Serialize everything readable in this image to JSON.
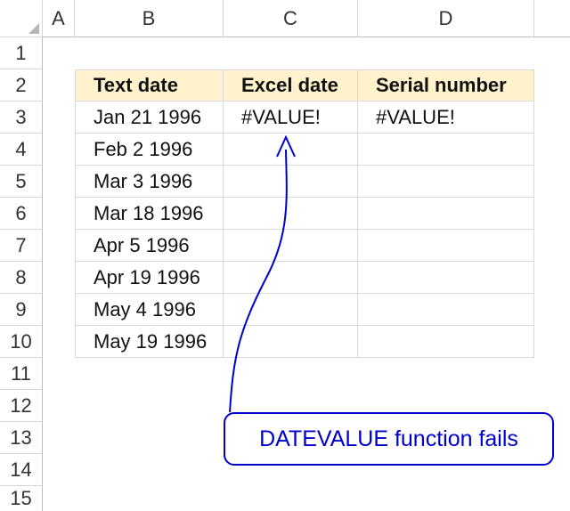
{
  "columns": [
    "A",
    "B",
    "C",
    "D"
  ],
  "rows": [
    "1",
    "2",
    "3",
    "4",
    "5",
    "6",
    "7",
    "8",
    "9",
    "10",
    "11",
    "12",
    "13",
    "14",
    "15"
  ],
  "table": {
    "headers": [
      "Text date",
      "Excel date",
      "Serial number"
    ],
    "data": [
      [
        "Jan 21 1996",
        "#VALUE!",
        "#VALUE!"
      ],
      [
        "Feb 2 1996",
        "",
        ""
      ],
      [
        "Mar 3 1996",
        "",
        ""
      ],
      [
        "Mar 18 1996",
        "",
        ""
      ],
      [
        "Apr 5 1996",
        "",
        ""
      ],
      [
        "Apr 19 1996",
        "",
        ""
      ],
      [
        "May 4 1996",
        "",
        ""
      ],
      [
        "May 19 1996",
        "",
        ""
      ]
    ]
  },
  "callout": {
    "text": "DATEVALUE function fails"
  },
  "colors": {
    "header_fill": "#fff2cc",
    "annotation": "#0000cc",
    "gridline": "#d9d9d9"
  }
}
